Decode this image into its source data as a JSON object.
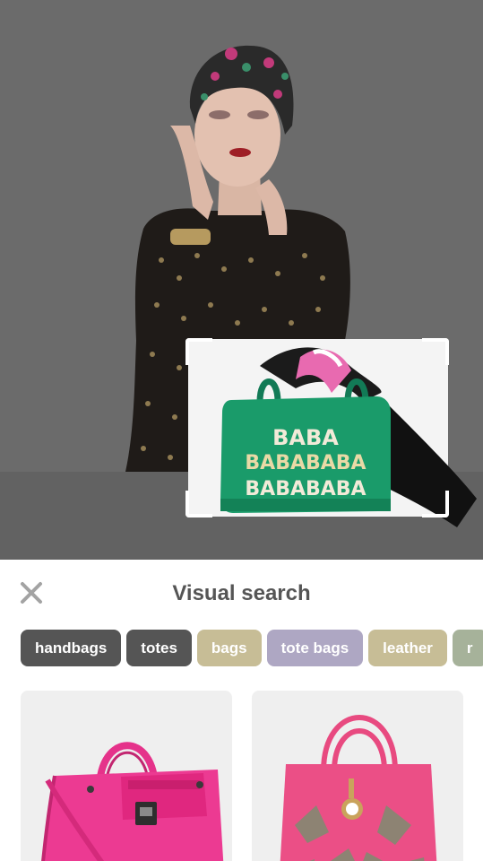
{
  "header": {
    "title": "Visual search"
  },
  "crop": {
    "product_text": [
      "BABA",
      "BABABABA",
      "BABABABA"
    ]
  },
  "chips": [
    {
      "label": "handbags",
      "color": "#555555"
    },
    {
      "label": "totes",
      "color": "#555555"
    },
    {
      "label": "bags",
      "color": "#c7bd96"
    },
    {
      "label": "tote bags",
      "color": "#aea7c3"
    },
    {
      "label": "leather",
      "color": "#c7bd96"
    },
    {
      "label": "r",
      "color": "#a6b29a"
    }
  ],
  "results": [
    {
      "name": "pink-leather-satchel",
      "color": "#e9318a"
    },
    {
      "name": "pink-cutout-tote",
      "color": "#ea4f83"
    }
  ]
}
